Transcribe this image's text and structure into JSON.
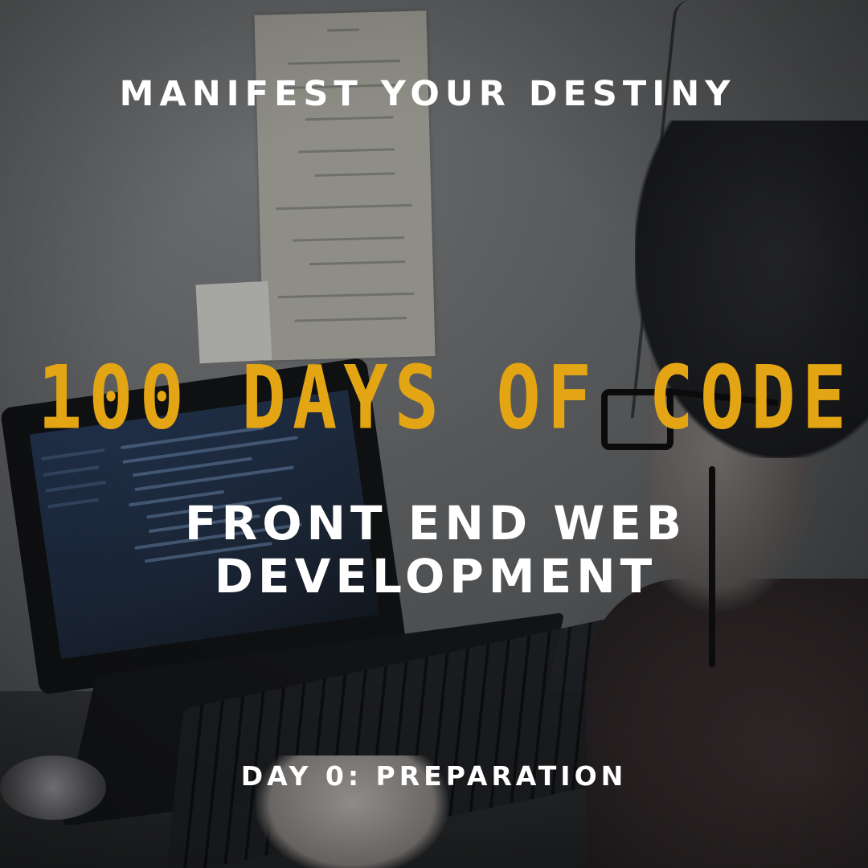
{
  "poster": {
    "tagline": "MANIFEST YOUR DESTINY",
    "headline": "100 DAYS OF CODE",
    "subtitle_line1": "FRONT END WEB",
    "subtitle_line2": "DEVELOPMENT",
    "day_label": "DAY 0: PREPARATION"
  },
  "colors": {
    "headline": "#e3a513",
    "text": "#ffffff",
    "overlay": "#1e2124"
  }
}
